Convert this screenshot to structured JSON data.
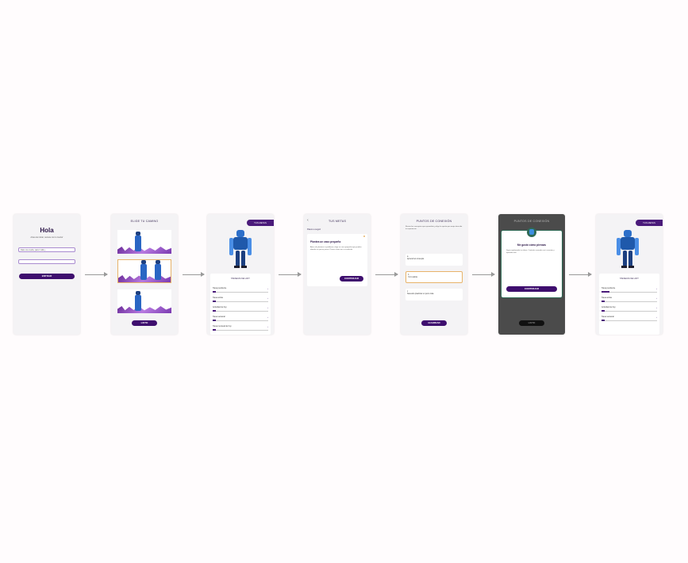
{
  "screen1": {
    "greeting": "Hola",
    "subtitle": "Antes de iniciar, reúnete con tu mentor",
    "input_value": "Dale una vuelta, para ir allá y",
    "input_placeholder": "",
    "button": "Entrar"
  },
  "screen2": {
    "title": "Elige tu camino",
    "button": "Listo"
  },
  "screen3": {
    "badge": "Tus metas",
    "section_title": "Tareas de hoy",
    "items": [
      "Tarea pendiente",
      "Tarea activa",
      "Actividad de hoy",
      "Tarea semanal",
      "Tarea mensual de hoy"
    ]
  },
  "screen4": {
    "title": "Tus metas",
    "back_label": "‹",
    "label": "Pasos a seguir",
    "card_title": "Plantea un caso pequeño",
    "card_text": "Antes de plantear tu problema, elige un caso pequeño que puedas abordar en pocos pasos. Piensa cómo vas a resolverlo",
    "button": "Continuar"
  },
  "screen5": {
    "title": "Puntos de conexión",
    "intro": "Revisa los conceptos que aprendiste y elige la opción que mejor describa tu experiencia",
    "options": [
      "Aprendí el concepto",
      "Ya lo sabía",
      "Necesito practicar un poco más"
    ],
    "button": "Guardar"
  },
  "screen6": {
    "title": "Puntos de conexión",
    "modal_title": "Me gustó cómo piensas",
    "modal_text": "Sigue explorando tus ideas. Continúa creando con tu mentor y aprende más",
    "button": "Continuar",
    "bg_button": "Listo"
  },
  "screen7": {
    "badge": "Tus metas",
    "section_title": "Tareas de hoy",
    "items": [
      "Tarea pendiente",
      "Tarea activa",
      "Actividad de hoy",
      "Tarea semanal"
    ]
  },
  "colors": {
    "primary": "#3e0e6e",
    "accent": "#e8b36a",
    "robot": "#2d6fc9"
  }
}
